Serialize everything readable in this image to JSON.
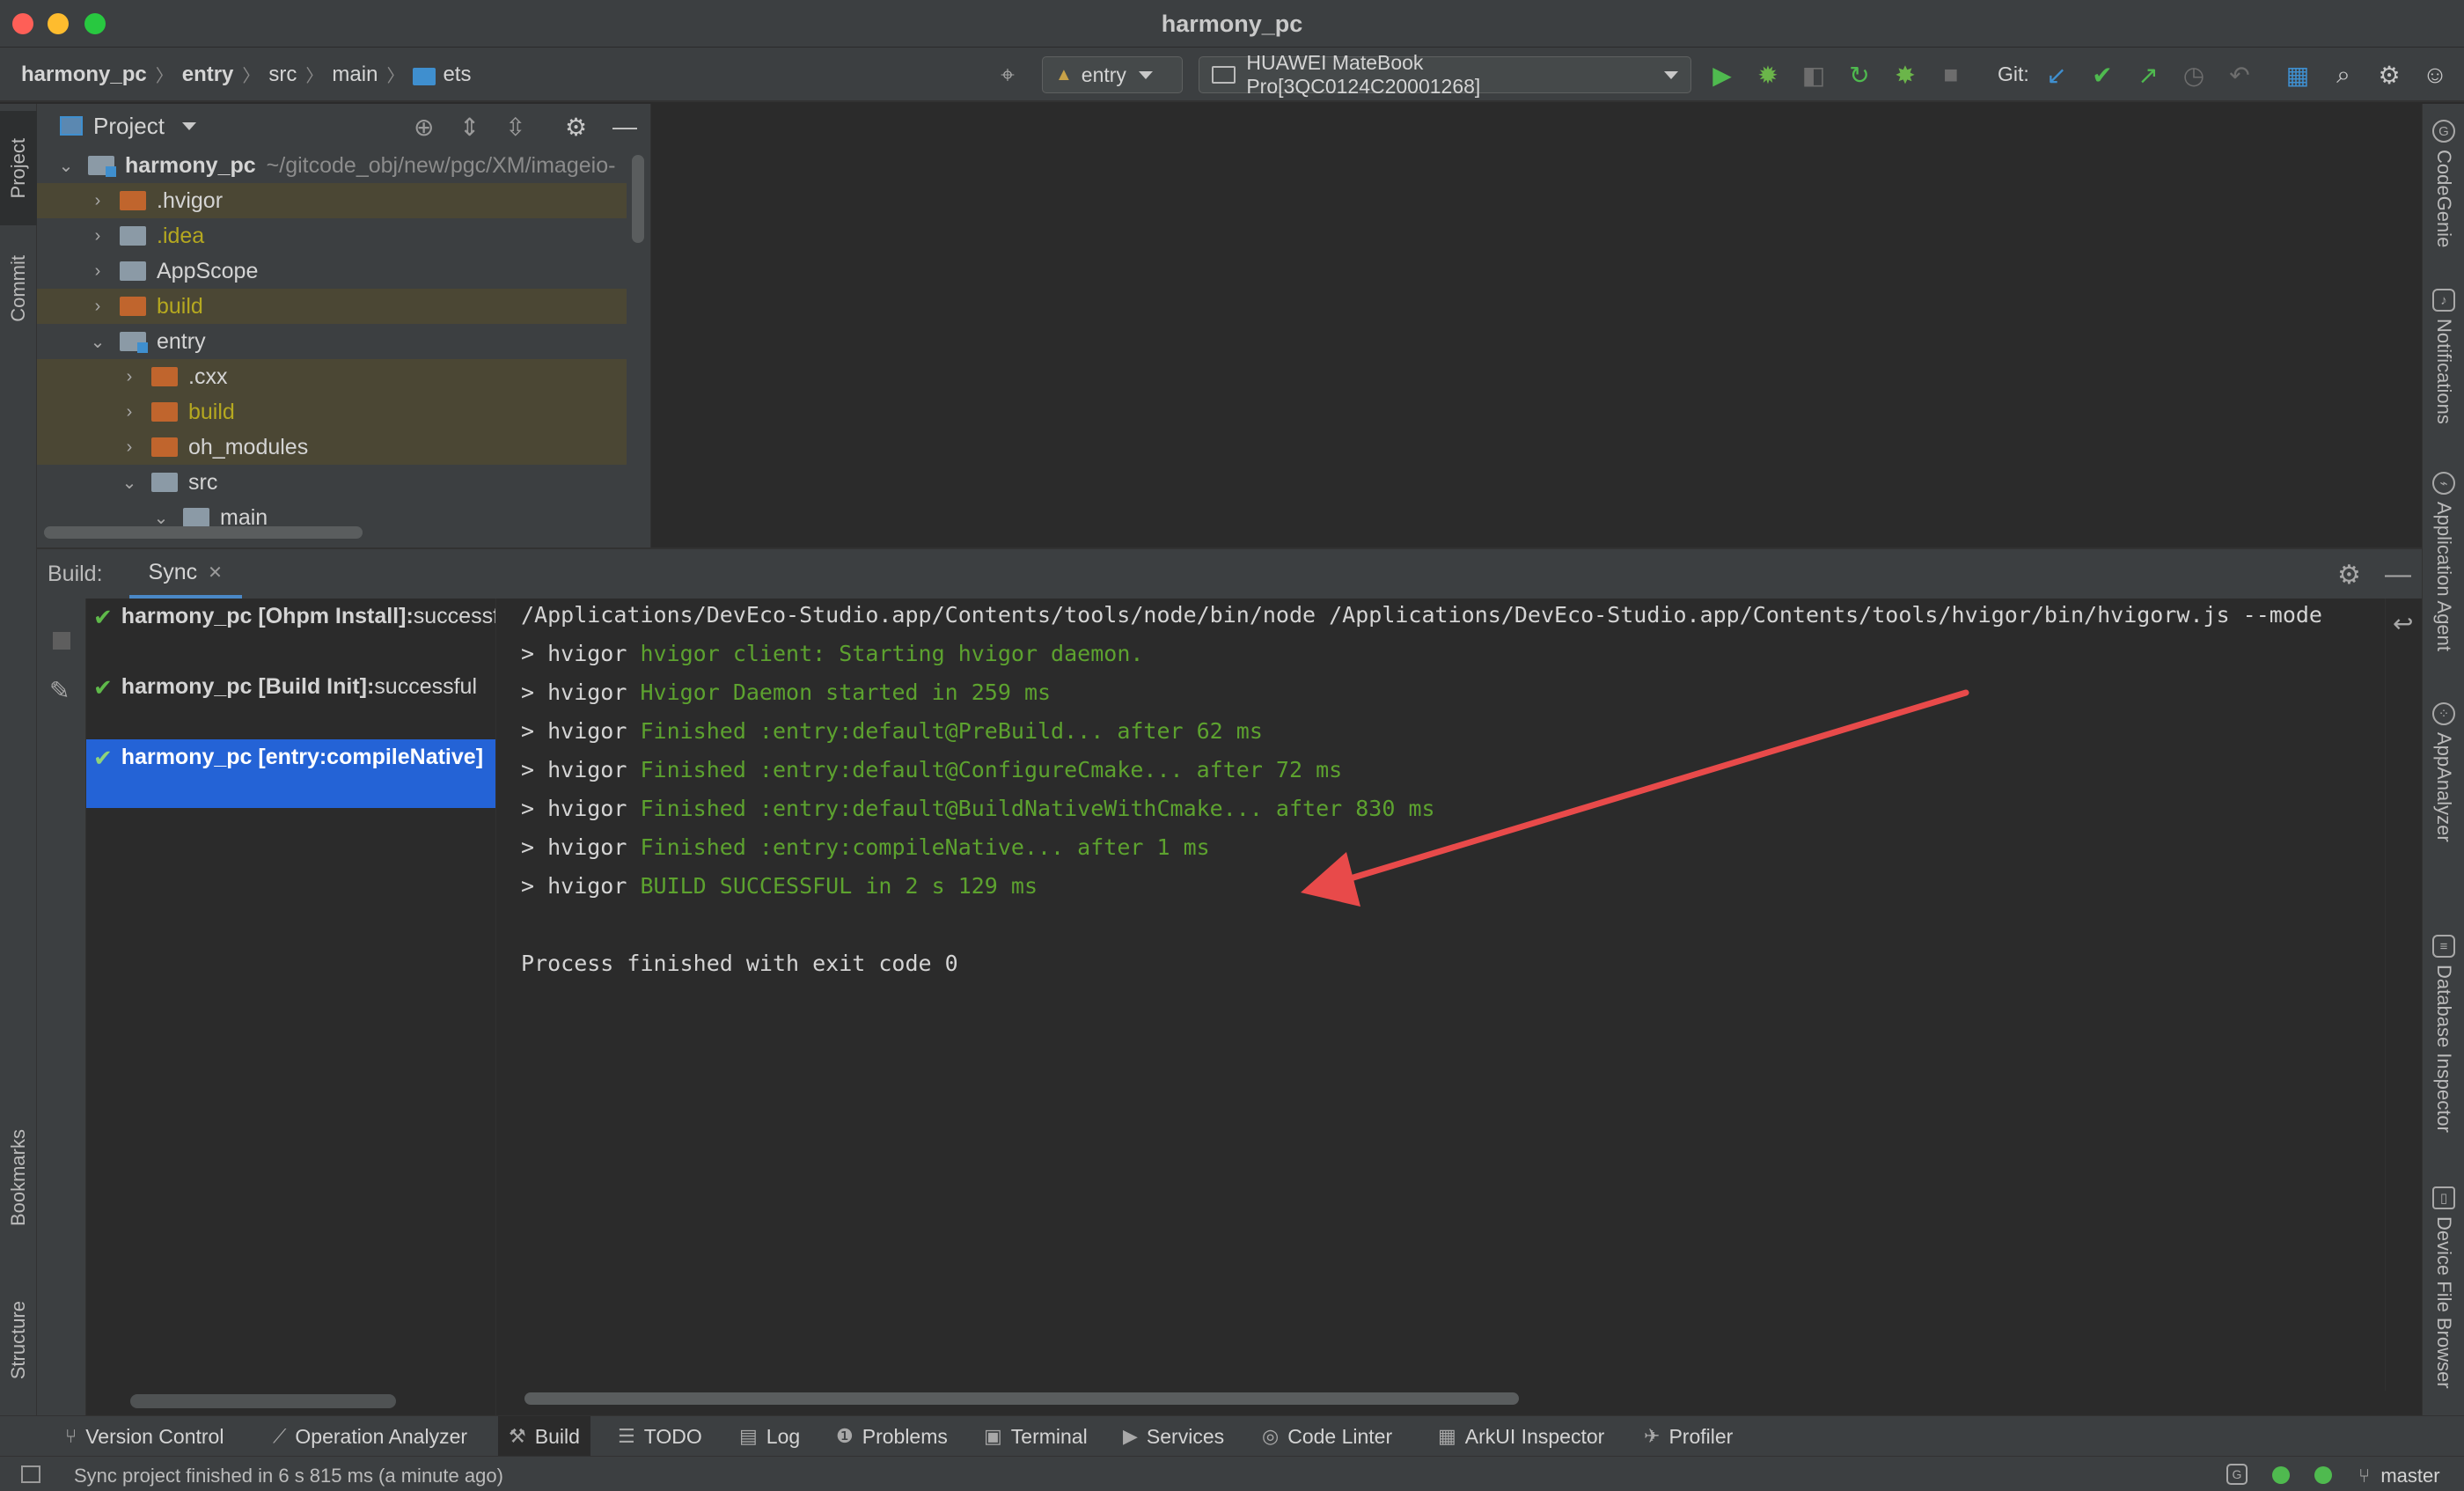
{
  "window": {
    "title": "harmony_pc"
  },
  "breadcrumbs": [
    "harmony_pc",
    "entry",
    "src",
    "main",
    "ets"
  ],
  "toolbar": {
    "module_select": "entry",
    "device_select": "HUAWEI MateBook Pro[3QC0124C20001268]",
    "git_label": "Git:",
    "icons": [
      "locate-icon",
      "run-icon",
      "debug-icon",
      "attach-debugger-icon",
      "rerun-icon",
      "apply-changes-icon",
      "stop-icon",
      "git-update-icon",
      "git-commit-icon",
      "git-push-icon",
      "history-icon",
      "rollback-icon",
      "project-structure-icon",
      "search-icon",
      "settings-icon",
      "account-icon"
    ]
  },
  "left_strip": {
    "tabs": [
      "Project",
      "Commit",
      "Bookmarks",
      "Structure"
    ]
  },
  "right_strip": {
    "tabs": [
      "CodeGenie",
      "Notifications",
      "Application Agent",
      "AppAnalyzer",
      "Database Inspector",
      "Device File Browser"
    ]
  },
  "project_panel": {
    "title": "Project",
    "tree": [
      {
        "label": "harmony_pc",
        "path": "~/gitcode_obj/new/pgc/XM/imageio-",
        "indent": 0,
        "expanded": true,
        "kind": "module"
      },
      {
        "label": ".hvigor",
        "indent": 1,
        "expanded": false,
        "kind": "orange",
        "excluded": true
      },
      {
        "label": ".idea",
        "indent": 1,
        "expanded": false,
        "kind": "grey",
        "yellow": true
      },
      {
        "label": "AppScope",
        "indent": 1,
        "expanded": false,
        "kind": "grey"
      },
      {
        "label": "build",
        "indent": 1,
        "expanded": false,
        "kind": "orange",
        "excluded": true,
        "yellow": true
      },
      {
        "label": "entry",
        "indent": 1,
        "expanded": true,
        "kind": "module"
      },
      {
        "label": ".cxx",
        "indent": 2,
        "expanded": false,
        "kind": "orange",
        "excluded": true
      },
      {
        "label": "build",
        "indent": 2,
        "expanded": false,
        "kind": "orange",
        "excluded": true,
        "yellow": true
      },
      {
        "label": "oh_modules",
        "indent": 2,
        "expanded": false,
        "kind": "orange",
        "excluded": true
      },
      {
        "label": "src",
        "indent": 2,
        "expanded": true,
        "kind": "grey"
      },
      {
        "label": "main",
        "indent": 3,
        "expanded": true,
        "kind": "grey"
      }
    ]
  },
  "build_panel": {
    "label": "Build:",
    "tab": "Sync",
    "tree": [
      {
        "bold": "harmony_pc [Ohpm Install]:",
        "rest": " successful"
      },
      {
        "bold": "harmony_pc [Build Init]:",
        "rest": " successful"
      },
      {
        "bold": "harmony_pc [entry:compileNative]",
        "rest": "",
        "selected": true
      }
    ],
    "console": [
      {
        "prefix": "",
        "text": "/Applications/DevEco-Studio.app/Contents/tools/node/bin/node /Applications/DevEco-Studio.app/Contents/tools/hvigor/bin/hvigorw.js --mode",
        "green": false
      },
      {
        "prefix": "> hvigor ",
        "text": "hvigor client: Starting hvigor daemon.",
        "green": true
      },
      {
        "prefix": "> hvigor ",
        "text": "Hvigor Daemon started in 259 ms",
        "green": true
      },
      {
        "prefix": "> hvigor ",
        "text": "Finished :entry:default@PreBuild... after 62 ms",
        "green": true
      },
      {
        "prefix": "> hvigor ",
        "text": "Finished :entry:default@ConfigureCmake... after 72 ms",
        "green": true
      },
      {
        "prefix": "> hvigor ",
        "text": "Finished :entry:default@BuildNativeWithCmake... after 830 ms",
        "green": true
      },
      {
        "prefix": "> hvigor ",
        "text": "Finished :entry:compileNative... after 1 ms",
        "green": true
      },
      {
        "prefix": "> hvigor ",
        "text": "BUILD SUCCESSFUL in 2 s 129 ms",
        "green": true
      },
      {
        "prefix": "",
        "text": "",
        "green": false
      },
      {
        "prefix": "",
        "text": "Process finished with exit code 0",
        "green": false
      }
    ]
  },
  "bottom_tabs": [
    {
      "label": "Version Control",
      "icon": "branch-icon"
    },
    {
      "label": "Operation Analyzer",
      "icon": "chart-icon"
    },
    {
      "label": "Build",
      "icon": "hammer-icon",
      "active": true
    },
    {
      "label": "TODO",
      "icon": "list-icon"
    },
    {
      "label": "Log",
      "icon": "log-icon"
    },
    {
      "label": "Problems",
      "icon": "warning-icon"
    },
    {
      "label": "Terminal",
      "icon": "terminal-icon"
    },
    {
      "label": "Services",
      "icon": "play-circle-icon"
    },
    {
      "label": "Code Linter",
      "icon": "linter-icon"
    },
    {
      "label": "ArkUI Inspector",
      "icon": "inspector-icon"
    },
    {
      "label": "Profiler",
      "icon": "profiler-icon"
    }
  ],
  "status": {
    "message": "Sync project finished in 6 s 815 ms (a minute ago)",
    "branch": "master"
  },
  "colors": {
    "console_green": "#5da22f",
    "selection_blue": "#2463d6",
    "annotation_arrow": "#e84a4a",
    "excluded_bg": "#4b4734"
  }
}
